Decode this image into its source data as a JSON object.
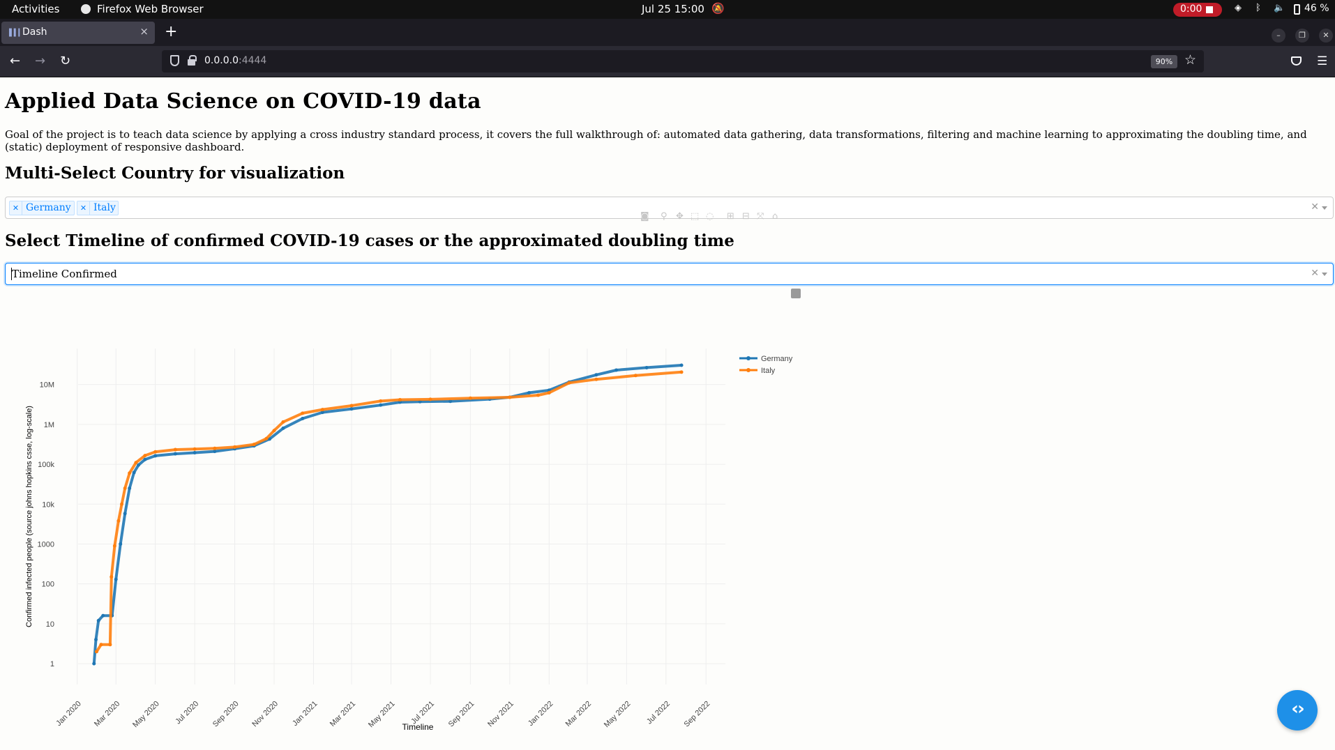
{
  "system_bar": {
    "activities": "Activities",
    "app_name": "Firefox Web Browser",
    "clock": "Jul 25  15:00",
    "record_time": "0:00",
    "battery": "46 %"
  },
  "browser": {
    "tab_title": "Dash",
    "url_host": "0.0.0.0",
    "url_port": ":4444",
    "zoom": "90%"
  },
  "page": {
    "title": "Applied Data Science on COVID-19 data",
    "description": "Goal of the project is to teach data science by applying a cross industry standard process, it covers the full walkthrough of: automated data gathering, data transformations, filtering and machine learning to approximating the doubling time, and (static) deployment of responsive dashboard.",
    "country_heading": "Multi-Select Country for visualization",
    "countries": [
      "Germany",
      "Italy"
    ],
    "timeline_heading": "Select Timeline of confirmed COVID-19 cases or the approximated doubling time",
    "timeline_value": "Timeline Confirmed"
  },
  "colors": {
    "germany": "#1f77b4",
    "italy": "#ff7f0e",
    "accent": "#007eff"
  },
  "icons": [
    "camera-icon",
    "zoom-icon",
    "pan-icon",
    "box-select-icon",
    "lasso-select-icon",
    "zoom-in-icon",
    "zoom-out-icon",
    "autoscale-icon",
    "reset-axes-icon",
    "plotly-logo-icon",
    "code-toggle-icon"
  ],
  "chart_data": {
    "type": "line",
    "xlabel": "Timeline",
    "ylabel": "Confirmed infected people (source johns hopkins csse, log-scale)",
    "y_scale": "log",
    "ylim": [
      0.3,
      80000000
    ],
    "xlim": [
      "2019-12-01",
      "2022-10-01"
    ],
    "x_ticks": [
      "Jan 2020",
      "Mar 2020",
      "May 2020",
      "Jul 2020",
      "Sep 2020",
      "Nov 2020",
      "Jan 2021",
      "Mar 2021",
      "May 2021",
      "Jul 2021",
      "Sep 2021",
      "Nov 2021",
      "Jan 2022",
      "Mar 2022",
      "May 2022",
      "Jul 2022",
      "Sep 2022"
    ],
    "y_ticks": [
      "1",
      "10",
      "100",
      "1000",
      "10k",
      "100k",
      "1M",
      "10M"
    ],
    "y_tick_values": [
      1,
      10,
      100,
      1000,
      10000,
      100000,
      1000000,
      10000000
    ],
    "legend_position": "right",
    "grid": true,
    "series": [
      {
        "name": "Germany",
        "points": [
          [
            "2020-01-27",
            1
          ],
          [
            "2020-01-30",
            4
          ],
          [
            "2020-02-03",
            12
          ],
          [
            "2020-02-10",
            16
          ],
          [
            "2020-02-24",
            16
          ],
          [
            "2020-03-01",
            130
          ],
          [
            "2020-03-08",
            1000
          ],
          [
            "2020-03-15",
            5800
          ],
          [
            "2020-03-22",
            25000
          ],
          [
            "2020-03-29",
            62000
          ],
          [
            "2020-04-05",
            96000
          ],
          [
            "2020-04-15",
            132000
          ],
          [
            "2020-05-01",
            163000
          ],
          [
            "2020-06-01",
            183000
          ],
          [
            "2020-07-01",
            195000
          ],
          [
            "2020-08-01",
            210000
          ],
          [
            "2020-09-01",
            245000
          ],
          [
            "2020-10-01",
            290000
          ],
          [
            "2020-10-25",
            430000
          ],
          [
            "2020-11-15",
            800000
          ],
          [
            "2020-12-15",
            1400000
          ],
          [
            "2021-01-15",
            2000000
          ],
          [
            "2021-03-01",
            2450000
          ],
          [
            "2021-04-15",
            3050000
          ],
          [
            "2021-05-15",
            3600000
          ],
          [
            "2021-06-15",
            3720000
          ],
          [
            "2021-08-01",
            3800000
          ],
          [
            "2021-10-01",
            4300000
          ],
          [
            "2021-11-01",
            4800000
          ],
          [
            "2021-12-01",
            6200000
          ],
          [
            "2022-01-01",
            7200000
          ],
          [
            "2022-02-01",
            11500000
          ],
          [
            "2022-03-15",
            17500000
          ],
          [
            "2022-04-15",
            23000000
          ],
          [
            "2022-06-01",
            26500000
          ],
          [
            "2022-07-25",
            30500000
          ]
        ]
      },
      {
        "name": "Italy",
        "points": [
          [
            "2020-01-31",
            2
          ],
          [
            "2020-02-07",
            3
          ],
          [
            "2020-02-21",
            3
          ],
          [
            "2020-02-23",
            150
          ],
          [
            "2020-02-28",
            900
          ],
          [
            "2020-03-05",
            3800
          ],
          [
            "2020-03-10",
            10000
          ],
          [
            "2020-03-15",
            25000
          ],
          [
            "2020-03-22",
            60000
          ],
          [
            "2020-04-01",
            110000
          ],
          [
            "2020-04-15",
            165000
          ],
          [
            "2020-05-01",
            205000
          ],
          [
            "2020-06-01",
            233000
          ],
          [
            "2020-07-01",
            241000
          ],
          [
            "2020-08-01",
            250000
          ],
          [
            "2020-09-01",
            270000
          ],
          [
            "2020-10-01",
            315000
          ],
          [
            "2020-10-20",
            440000
          ],
          [
            "2020-11-01",
            700000
          ],
          [
            "2020-11-15",
            1150000
          ],
          [
            "2020-12-15",
            1900000
          ],
          [
            "2021-01-15",
            2350000
          ],
          [
            "2021-03-01",
            2950000
          ],
          [
            "2021-04-15",
            3850000
          ],
          [
            "2021-05-15",
            4150000
          ],
          [
            "2021-07-01",
            4260000
          ],
          [
            "2021-09-01",
            4550000
          ],
          [
            "2021-11-01",
            4780000
          ],
          [
            "2021-12-15",
            5400000
          ],
          [
            "2022-01-01",
            6200000
          ],
          [
            "2022-02-01",
            11000000
          ],
          [
            "2022-03-15",
            13500000
          ],
          [
            "2022-05-15",
            16800000
          ],
          [
            "2022-07-25",
            20500000
          ]
        ]
      }
    ]
  }
}
